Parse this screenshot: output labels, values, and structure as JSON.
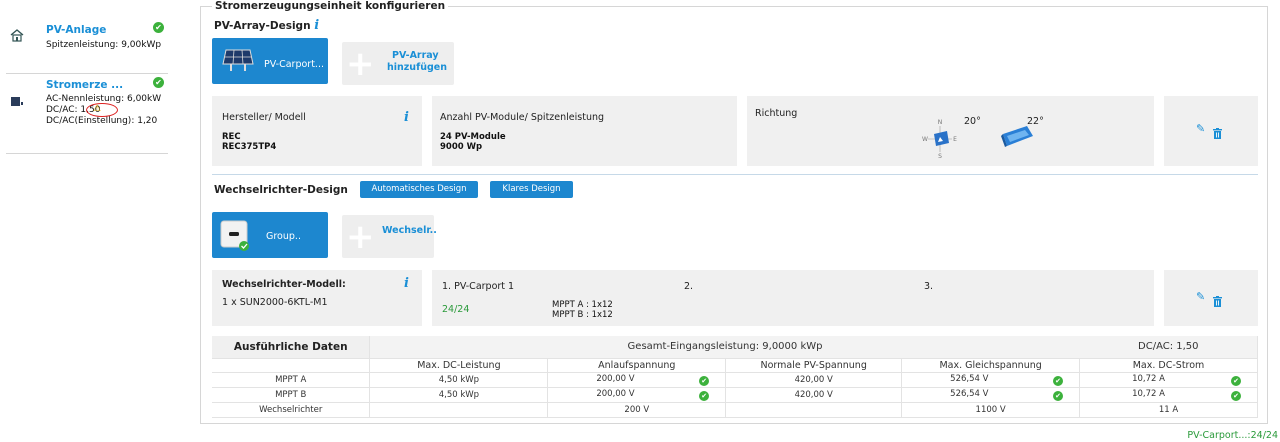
{
  "sidebar": {
    "items": [
      {
        "title": "PV-Anlage",
        "lines": [
          "Spitzenleistung: 9,00kWp"
        ]
      },
      {
        "title": "Stromerze ...",
        "lines": [
          "AC-Nennleistung: 6,00kW",
          "DC/AC: 1,50",
          "DC/AC(Einstellung): 1,20"
        ]
      }
    ]
  },
  "main": {
    "title": "Stromerzeugungseinheit konfigurieren",
    "pv_design_title": "PV-Array-Design",
    "pv_tile_label": "PV-Carport...",
    "pv_add_label_1": "PV-Array",
    "pv_add_label_2": "hinzufügen",
    "module_panel": {
      "label": "Hersteller/ Modell",
      "maker": "REC",
      "model": "REC375TP4"
    },
    "count_panel": {
      "label": "Anzahl PV-Module/ Spitzenleistung",
      "modules": "24 PV-Module",
      "power": "9000 Wp"
    },
    "direction_panel": {
      "label": "Richtung",
      "azimuth": "20°",
      "tilt": "22°",
      "compass": {
        "n": "N",
        "s": "S",
        "w": "W",
        "e": "E"
      }
    },
    "inverter_design_title": "Wechselrichter-Design",
    "btn_auto": "Automatisches Design",
    "btn_clear": "Klares Design",
    "inv_tile_label": "Group..",
    "inv_add_label": "Wechselr..",
    "inverter_panel": {
      "label": "Wechselrichter-Modell:",
      "value": "1 x SUN2000-6KTL-M1"
    },
    "mppt_panel": {
      "slot1": "1.  PV-Carport 1",
      "slot2": "2.",
      "slot3": "3.",
      "count": "24/24",
      "mppt_a": "MPPT A : 1x12",
      "mppt_b": "MPPT B : 1x12"
    }
  },
  "table": {
    "title": "Ausführliche Daten",
    "total": "Gesamt-Eingangsleistung: 9,0000 kWp",
    "dcac": "DC/AC: 1,50",
    "columns": [
      "",
      "Max. DC-Leistung",
      "Anlaufspannung",
      "Normale PV-Spannung",
      "Max. Gleichspannung",
      "Max. DC-Strom"
    ],
    "rows": [
      {
        "name": "MPPT A",
        "dc": "4,50 kWp",
        "start": "200,00 V",
        "normal": "420,00 V",
        "maxv": "526,54 V",
        "maxi": "10,72 A"
      },
      {
        "name": "MPPT B",
        "dc": "4,50 kWp",
        "start": "200,00 V",
        "normal": "420,00 V",
        "maxv": "526,54 V",
        "maxi": "10,72 A"
      },
      {
        "name": "Wechselrichter",
        "dc": "",
        "start": "200 V",
        "normal": "",
        "maxv": "1100 V",
        "maxi": "11 A"
      }
    ]
  },
  "footer": "PV-Carport...:24/24",
  "colors": {
    "accent": "#1d87cf",
    "success": "#3cb13c",
    "panel": "#f0f0f0"
  }
}
